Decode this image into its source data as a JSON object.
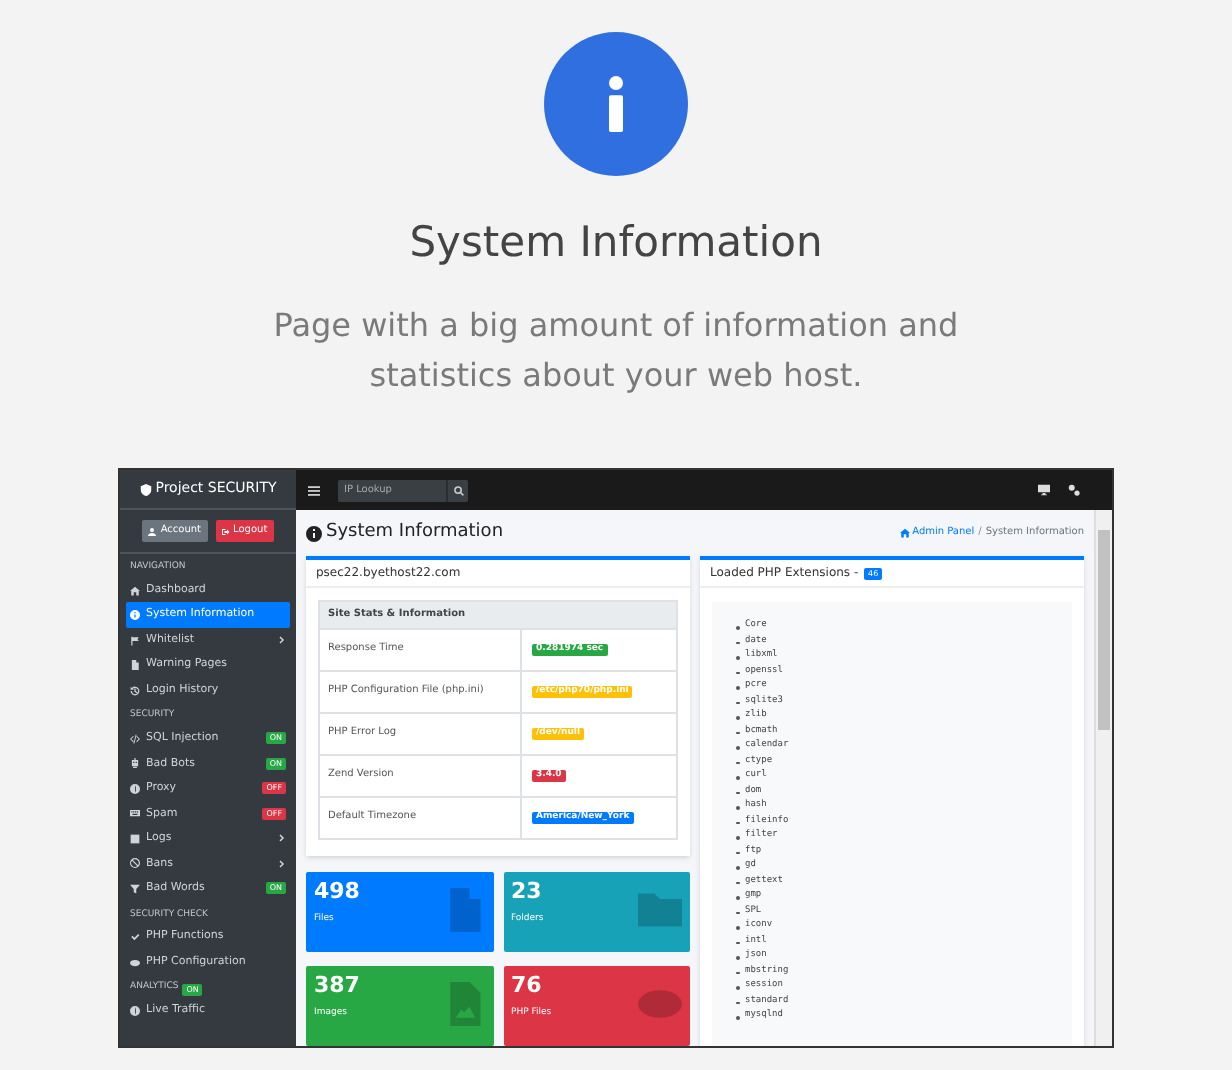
{
  "hero": {
    "title": "System Information",
    "subtitle": "Page with a big amount of information and statistics about your web host."
  },
  "app": {
    "brand": "Project SECURITY",
    "account_buttons": [
      {
        "label": "Account",
        "kind": "account"
      },
      {
        "label": "Logout",
        "kind": "logout"
      }
    ],
    "sidebar": [
      {
        "title": "NAVIGATION",
        "items": [
          {
            "label": "Dashboard",
            "selected": false
          },
          {
            "label": "System Information",
            "selected": true
          },
          {
            "label": "Whitelist",
            "selected": false,
            "chevron": true
          },
          {
            "label": "Warning Pages",
            "selected": false
          },
          {
            "label": "Login History",
            "selected": false
          }
        ]
      },
      {
        "title": "SECURITY",
        "items": [
          {
            "label": "SQL Injection",
            "selected": false,
            "badge": {
              "text": "ON",
              "color": "#28a745"
            }
          },
          {
            "label": "Bad Bots",
            "selected": false,
            "badge": {
              "text": "ON",
              "color": "#28a745"
            }
          },
          {
            "label": "Proxy",
            "selected": false,
            "badge": {
              "text": "OFF",
              "color": "#dc3545"
            }
          },
          {
            "label": "Spam",
            "selected": false,
            "badge": {
              "text": "OFF",
              "color": "#dc3545"
            }
          },
          {
            "label": "Logs",
            "selected": false,
            "chevron": true
          },
          {
            "label": "Bans",
            "selected": false,
            "chevron": true
          },
          {
            "label": "Bad Words",
            "selected": false,
            "badge": {
              "text": "ON",
              "color": "#28a745"
            }
          }
        ]
      },
      {
        "title": "SECURITY CHECK",
        "items": [
          {
            "label": "PHP Functions",
            "selected": false
          },
          {
            "label": "PHP Configuration",
            "selected": false
          }
        ]
      },
      {
        "title": "ANALYTICS",
        "badge": {
          "text": "ON",
          "color": "#28a745"
        },
        "items": [
          {
            "label": "Live Traffic",
            "selected": false
          }
        ]
      }
    ],
    "search": {
      "placeholder": "IP Lookup"
    },
    "page_title": "System Information",
    "breadcrumb": {
      "separator": "/",
      "items": [
        {
          "label": "Admin Panel",
          "kind": "link"
        },
        {
          "label": "System Information",
          "kind": "current"
        }
      ]
    },
    "host_card": {
      "header": "psec22.byethost22.com",
      "table_heading": "Site Stats & Information",
      "rows": [
        {
          "label": "Response Time",
          "value": "0.281974 sec",
          "color": "#28a745"
        },
        {
          "label": "PHP Configuration File (php.ini)",
          "value": "/etc/php70/php.ini",
          "color": "#ffc107"
        },
        {
          "label": "PHP Error Log",
          "value": "/dev/null",
          "color": "#ffc107"
        },
        {
          "label": "Zend Version",
          "value": "3.4.0",
          "color": "#dc3545"
        },
        {
          "label": "Default Timezone",
          "value": "America/New_York",
          "color": "#007bff"
        }
      ]
    },
    "stats": [
      {
        "value": "498",
        "label": "Files",
        "color": "#007bff"
      },
      {
        "value": "23",
        "label": "Folders",
        "color": "#17a2b8"
      },
      {
        "value": "387",
        "label": "Images",
        "color": "#28a745"
      },
      {
        "value": "76",
        "label": "PHP Files",
        "color": "#dc3545"
      }
    ],
    "extensions_card": {
      "header": "Loaded PHP Extensions - ",
      "count": "46",
      "items": [
        "Core",
        "date",
        "libxml",
        "openssl",
        "pcre",
        "sqlite3",
        "zlib",
        "bcmath",
        "calendar",
        "ctype",
        "curl",
        "dom",
        "hash",
        "fileinfo",
        "filter",
        "ftp",
        "gd",
        "gettext",
        "gmp",
        "SPL",
        "iconv",
        "intl",
        "json",
        "mbstring",
        "session",
        "standard",
        "mysqlnd"
      ]
    }
  }
}
